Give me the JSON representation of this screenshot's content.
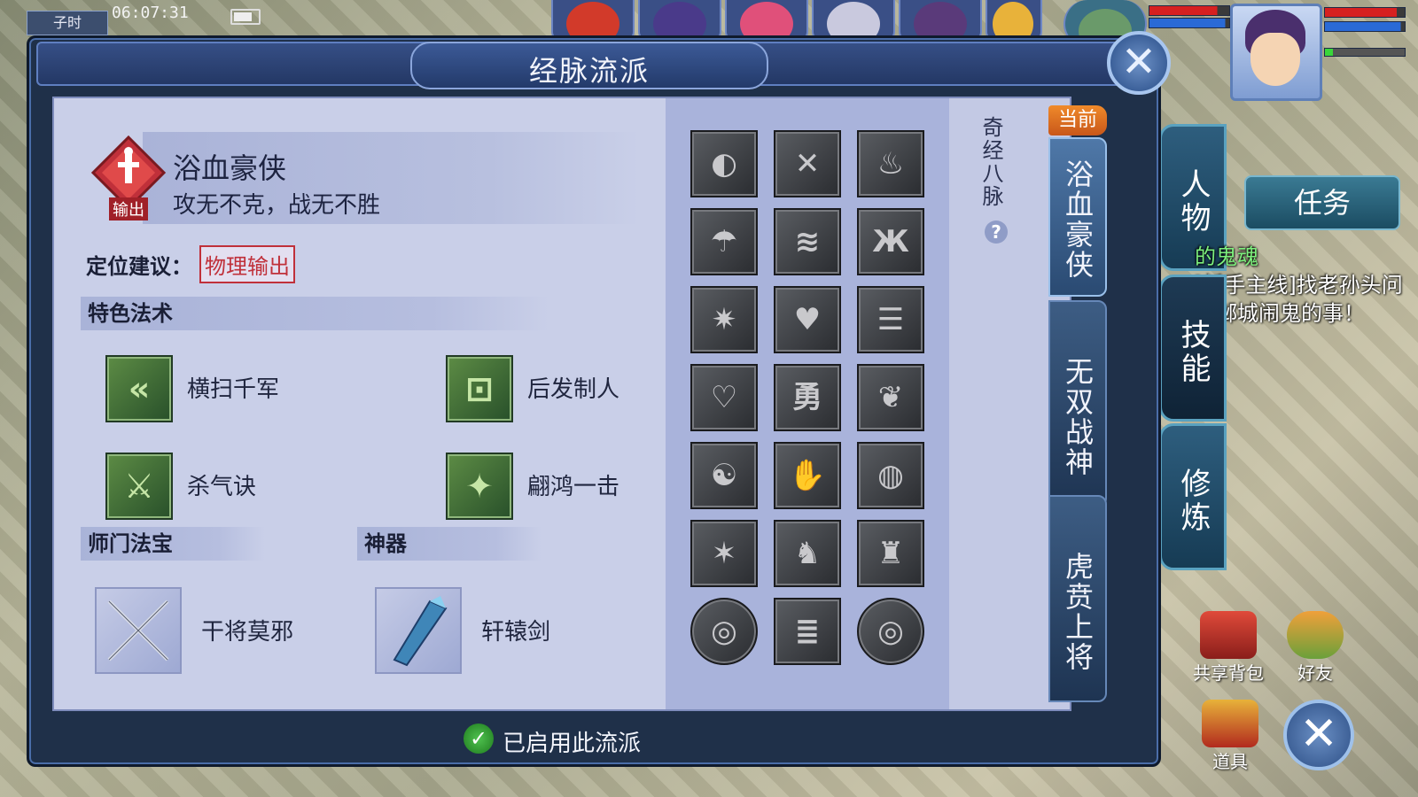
{
  "hud": {
    "time": "06:07:31",
    "shichen": "子时",
    "task_button": "任务",
    "quest_lines": [
      "的鬼魂",
      "[新手主线]找老孙头问",
      "建邺城闹鬼的事！"
    ],
    "shared_bag": "共享背包",
    "friends": "好友",
    "items": "道具"
  },
  "side_menu": {
    "character": "人物",
    "skills": "技能",
    "cultivate": "修炼"
  },
  "panel": {
    "title": "经脉流派",
    "school": {
      "name": "浴血豪侠",
      "motto": "攻无不克，战无不胜",
      "emblem_text": "输出"
    },
    "positioning_label": "定位建议：",
    "positioning_tag": "物理输出",
    "special_skills_header": "特色法术",
    "special_skills": [
      {
        "name": "横扫千军",
        "glyph": "«"
      },
      {
        "name": "后发制人",
        "glyph": "⊡"
      },
      {
        "name": "杀气诀",
        "glyph": "⚔"
      },
      {
        "name": "翩鸿一击",
        "glyph": "✦"
      }
    ],
    "treasure_header": "师门法宝",
    "artifact_header": "神器",
    "treasure": {
      "name": "干将莫邪"
    },
    "artifact": {
      "name": "轩辕剑"
    },
    "meridian_title": "奇经八脉",
    "help": "?",
    "meridian_glyphs": [
      "◐",
      "✕",
      "♨",
      "☂",
      "≋",
      "Ж",
      "✷",
      "♥",
      "☰",
      "♡",
      "勇",
      "❦",
      "☯",
      "✋",
      "◍",
      "✶",
      "♞",
      "♜",
      "◎",
      "≣",
      "◎"
    ],
    "school_tabs": [
      "浴血豪侠",
      "无双战神",
      "虎贲上将"
    ],
    "current_badge": "当前",
    "footer_text": "已启用此流派",
    "check": "✓",
    "close": "✕"
  },
  "colors": {
    "panel_bg": "#1f3049",
    "inner_bg": "#c7cde6",
    "accent_red": "#c0303a",
    "badge_orange": "#f08a2a",
    "check_green": "#3faa3f"
  }
}
